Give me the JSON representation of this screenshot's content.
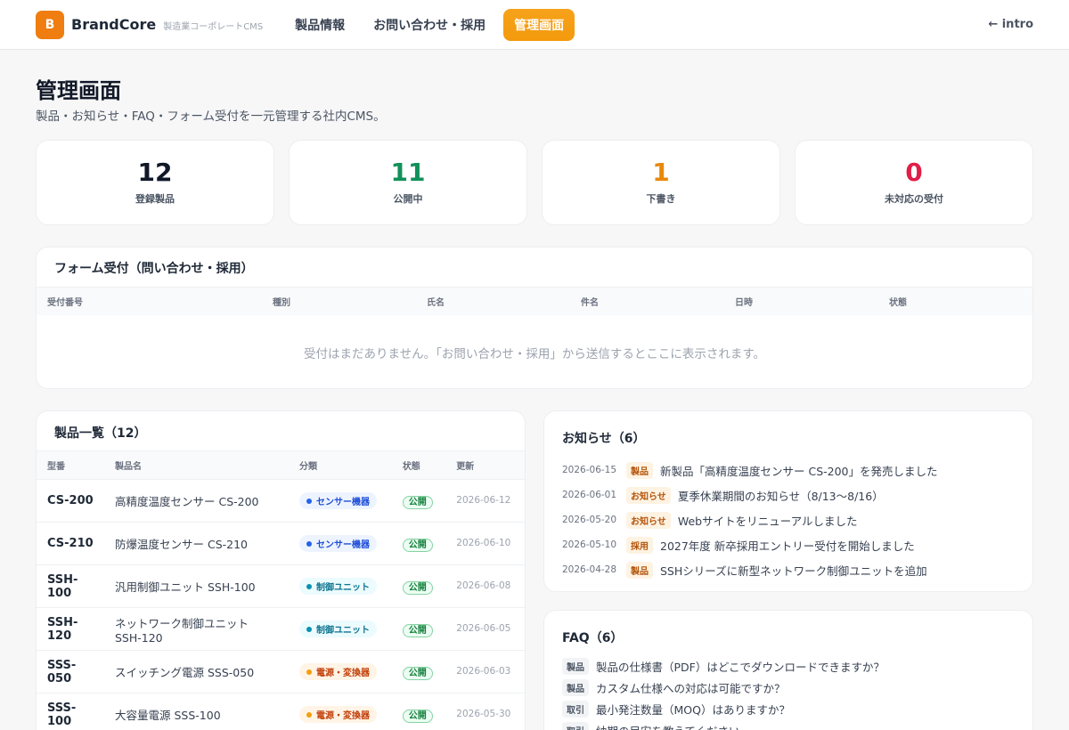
{
  "header": {
    "logo_letter": "B",
    "brand": "BrandCore",
    "brand_sub": "製造業コーポレートCMS",
    "nav": [
      {
        "label": "製品情報"
      },
      {
        "label": "お問い合わせ・採用"
      },
      {
        "label": "管理画面",
        "active": true
      }
    ],
    "intro_label": "← intro"
  },
  "page": {
    "title": "管理画面",
    "subtitle": "製品・お知らせ・FAQ・フォーム受付を一元管理する社内CMS。"
  },
  "stats": [
    {
      "value": "12",
      "label": "登録製品",
      "color": "#111827"
    },
    {
      "value": "11",
      "label": "公開中",
      "color": "#12915a"
    },
    {
      "value": "1",
      "label": "下書き",
      "color": "#e8890c"
    },
    {
      "value": "0",
      "label": "未対応の受付",
      "color": "#e11d48"
    }
  ],
  "forms": {
    "title": "フォーム受付（問い合わせ・採用）",
    "columns": [
      "受付番号",
      "種別",
      "氏名",
      "件名",
      "日時",
      "状態"
    ],
    "empty_message": "受付はまだありません。「お問い合わせ・採用」から送信するとここに表示されます。"
  },
  "products": {
    "title": "製品一覧（12）",
    "columns": [
      "型番",
      "製品名",
      "分類",
      "状態",
      "更新"
    ],
    "rows": [
      {
        "model": "CS-200",
        "name": "高精度温度センサー CS-200",
        "category": "センサー機器",
        "cat_style": "blue",
        "status": "公開",
        "date": "2026-06-12"
      },
      {
        "model": "CS-210",
        "name": "防爆温度センサー CS-210",
        "category": "センサー機器",
        "cat_style": "blue",
        "status": "公開",
        "date": "2026-06-10"
      },
      {
        "model": "SSH-100",
        "name": "汎用制御ユニット SSH-100",
        "category": "制御ユニット",
        "cat_style": "teal",
        "status": "公開",
        "date": "2026-06-08"
      },
      {
        "model": "SSH-120",
        "name": "ネットワーク制御ユニット SSH-120",
        "category": "制御ユニット",
        "cat_style": "teal",
        "status": "公開",
        "date": "2026-06-05"
      },
      {
        "model": "SSS-050",
        "name": "スイッチング電源 SSS-050",
        "category": "電源・変換器",
        "cat_style": "orange",
        "status": "公開",
        "date": "2026-06-03"
      },
      {
        "model": "SSS-100",
        "name": "大容量電源 SSS-100",
        "category": "電源・変換器",
        "cat_style": "orange",
        "status": "公開",
        "date": "2026-05-30"
      }
    ]
  },
  "news": {
    "title": "お知らせ（6）",
    "items": [
      {
        "date": "2026-06-15",
        "tag": "製品",
        "title": "新製品「高精度温度センサー CS-200」を発売しました"
      },
      {
        "date": "2026-06-01",
        "tag": "お知らせ",
        "title": "夏季休業期間のお知らせ（8/13〜8/16）"
      },
      {
        "date": "2026-05-20",
        "tag": "お知らせ",
        "title": "Webサイトをリニューアルしました"
      },
      {
        "date": "2026-05-10",
        "tag": "採用",
        "title": "2027年度 新卒採用エントリー受付を開始しました"
      },
      {
        "date": "2026-04-28",
        "tag": "製品",
        "title": "SSHシリーズに新型ネットワーク制御ユニットを追加"
      }
    ]
  },
  "faq": {
    "title": "FAQ（6）",
    "items": [
      {
        "tag": "製品",
        "q": "製品の仕様書（PDF）はどこでダウンロードできますか？"
      },
      {
        "tag": "製品",
        "q": "カスタム仕様への対応は可能ですか？"
      },
      {
        "tag": "取引",
        "q": "最小発注数量（MOQ）はありますか？"
      },
      {
        "tag": "取引",
        "q": "納期の目安を教えてください"
      }
    ]
  }
}
